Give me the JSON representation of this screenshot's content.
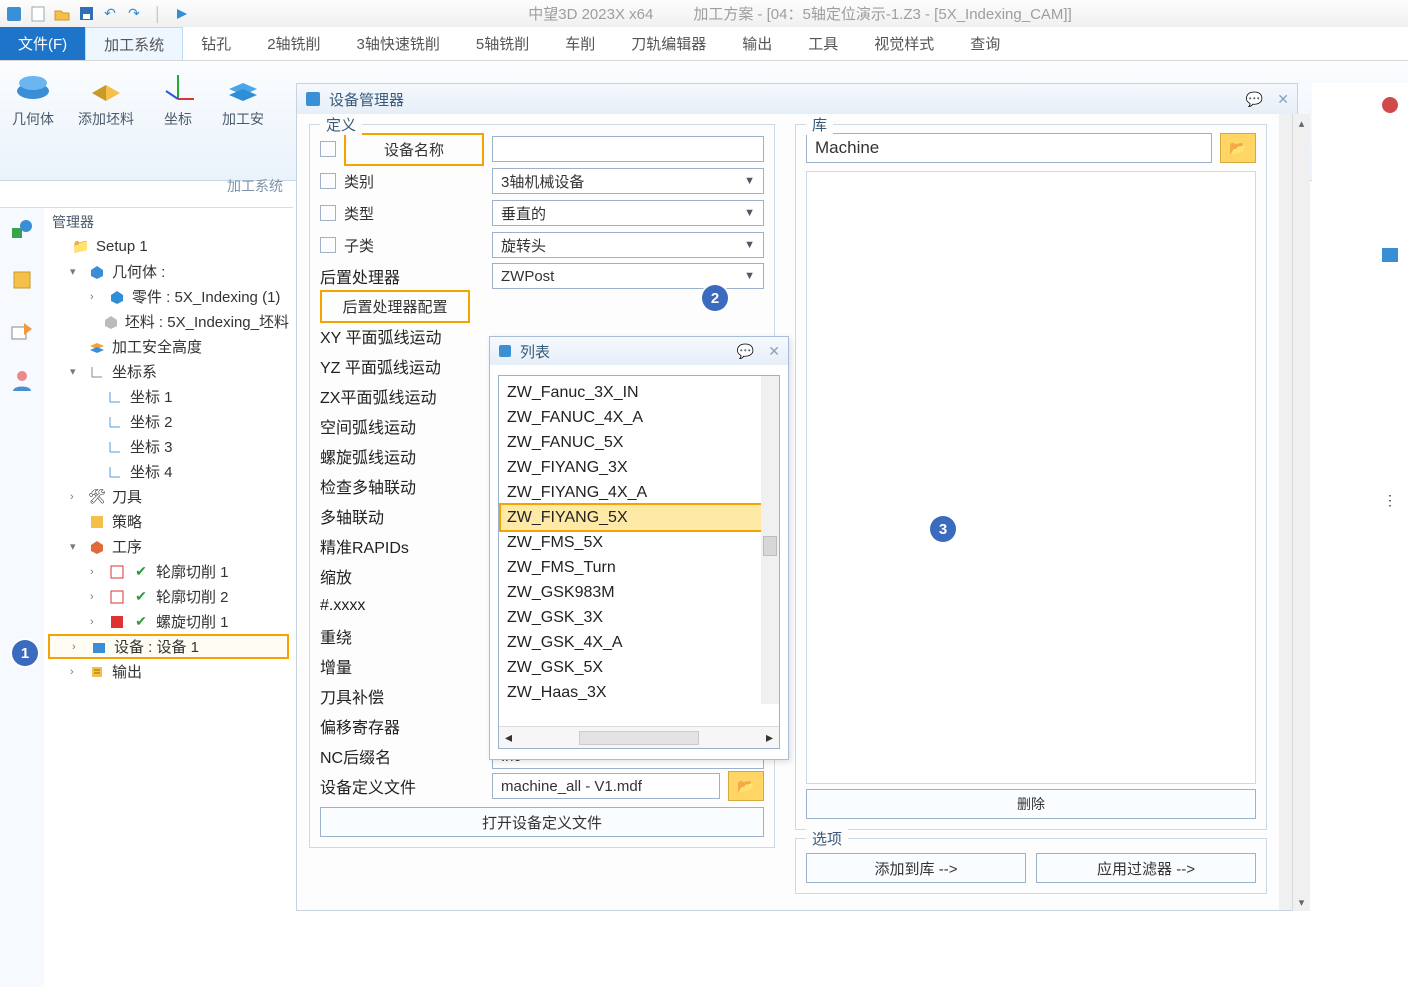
{
  "titlebar": {
    "app": "中望3D 2023X x64",
    "doc": "加工方案 - [04：5轴定位演示-1.Z3 - [5X_Indexing_CAM]]"
  },
  "ribbonTabs": {
    "t0": "文件(F)",
    "t1": "加工系统",
    "t2": "钻孔",
    "t3": "2轴铣削",
    "t4": "3轴快速铣削",
    "t5": "5轴铣削",
    "t6": "车削",
    "t7": "刀轨编辑器",
    "t8": "输出",
    "t9": "工具",
    "t10": "视觉样式",
    "t11": "查询"
  },
  "ribbon": {
    "g0": "几何体",
    "g1": "添加坯料",
    "g2": "坐标",
    "g3": "加工安",
    "footer": "加工系统"
  },
  "treeHeader": "管理器",
  "tree": {
    "n0": "Setup 1",
    "n1": "几何体 :",
    "n2": "零件 : 5X_Indexing (1)",
    "n3": "坯料 : 5X_Indexing_坯料",
    "n4": "加工安全高度",
    "n5": "坐标系",
    "n6": "坐标 1",
    "n7": "坐标 2",
    "n8": "坐标 3",
    "n9": "坐标 4",
    "n10": "刀具",
    "n11": "策略",
    "n12": "工序",
    "n13": "轮廓切削 1",
    "n14": "轮廓切削 2",
    "n15": "螺旋切削 1",
    "n16": "设备 : 设备 1",
    "n17": "输出"
  },
  "dlg": {
    "title": "设备管理器",
    "def": {
      "legend": "定义",
      "nameLabel": "设备名称",
      "category": "类别",
      "categoryVal": "3轴机械设备",
      "type": "类型",
      "typeVal": "垂直的",
      "subcat": "子类",
      "subcatVal": "旋转头",
      "post": "后置处理器",
      "postVal": "ZWPost",
      "postCfg": "后置处理器配置",
      "rows": {
        "r0": "XY 平面弧线运动",
        "r1": "YZ 平面弧线运动",
        "r2": "ZX平面弧线运动",
        "r3": "空间弧线运动",
        "r4": "螺旋弧线运动",
        "r5": "检查多轴联动",
        "r6": "多轴联动",
        "r7": "精准RAPIDs",
        "r8": "缩放",
        "r9": "#.xxxx",
        "r10": "重绕",
        "r11": "增量",
        "r12": "刀具补偿",
        "r13": "偏移寄存器"
      },
      "ncSuffix": "NC后缀名",
      "ncSuffixVal": ".nc",
      "defFile": "设备定义文件",
      "defFileVal": "machine_all - V1.mdf",
      "openBtn": "打开设备定义文件"
    },
    "lib": {
      "legend": "库",
      "value": "Machine",
      "delete": "删除",
      "opts": "选项",
      "addToLib": "添加到库 -->",
      "applyFilter": "应用过滤器 -->"
    }
  },
  "subdlg": {
    "title": "列表",
    "items": {
      "i0": "ZW_Fanuc_3X_IN",
      "i1": "ZW_FANUC_4X_A",
      "i2": "ZW_FANUC_5X",
      "i3": "ZW_FIYANG_3X",
      "i4": "ZW_FIYANG_4X_A",
      "i5": "ZW_FIYANG_5X",
      "i6": "ZW_FMS_5X",
      "i7": "ZW_FMS_Turn",
      "i8": "ZW_GSK983M",
      "i9": "ZW_GSK_3X",
      "i10": "ZW_GSK_4X_A",
      "i11": "ZW_GSK_5X",
      "i12": "ZW_Haas_3X"
    }
  },
  "badges": {
    "b1": "1",
    "b2": "2",
    "b3": "3"
  }
}
